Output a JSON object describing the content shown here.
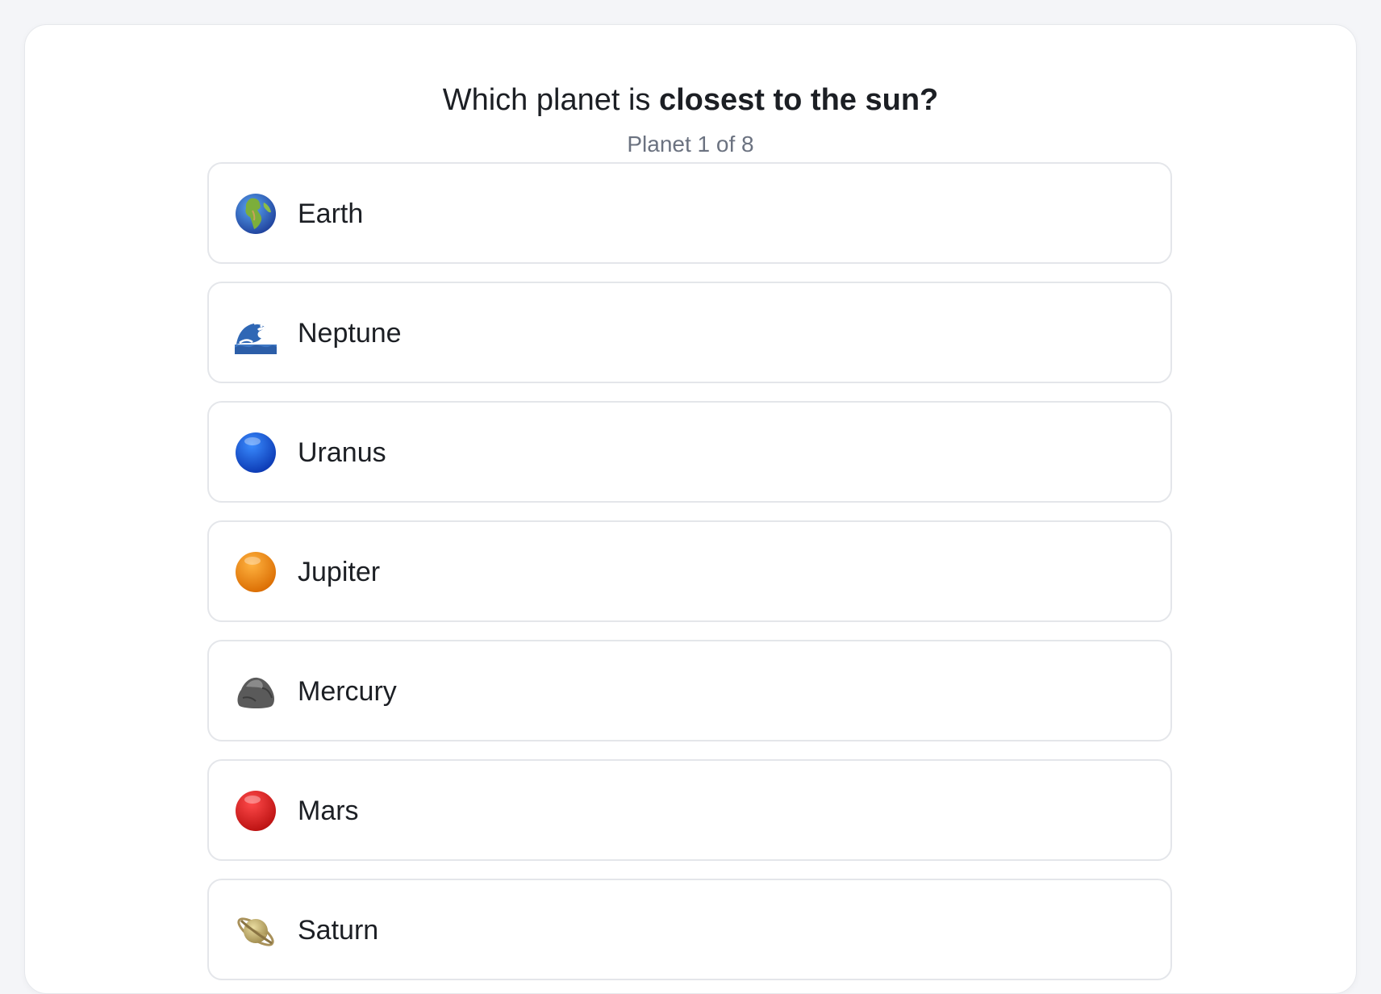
{
  "quiz": {
    "question_prefix": "Which planet is ",
    "question_emphasis": "closest to the sun?",
    "progress": "Planet 1 of 8"
  },
  "options": [
    {
      "label": "Earth",
      "icon": "earth-globe-icon"
    },
    {
      "label": "Neptune",
      "icon": "wave-icon"
    },
    {
      "label": "Uranus",
      "icon": "blue-circle-icon"
    },
    {
      "label": "Jupiter",
      "icon": "orange-circle-icon"
    },
    {
      "label": "Mercury",
      "icon": "rock-icon"
    },
    {
      "label": "Mars",
      "icon": "red-circle-icon"
    },
    {
      "label": "Saturn",
      "icon": "ringed-planet-icon"
    }
  ],
  "colors": {
    "page_background": "#f4f5f8",
    "card_background": "#ffffff",
    "option_border": "#e4e6ea",
    "text_primary": "#1c1f24",
    "text_secondary": "#6b7280"
  }
}
